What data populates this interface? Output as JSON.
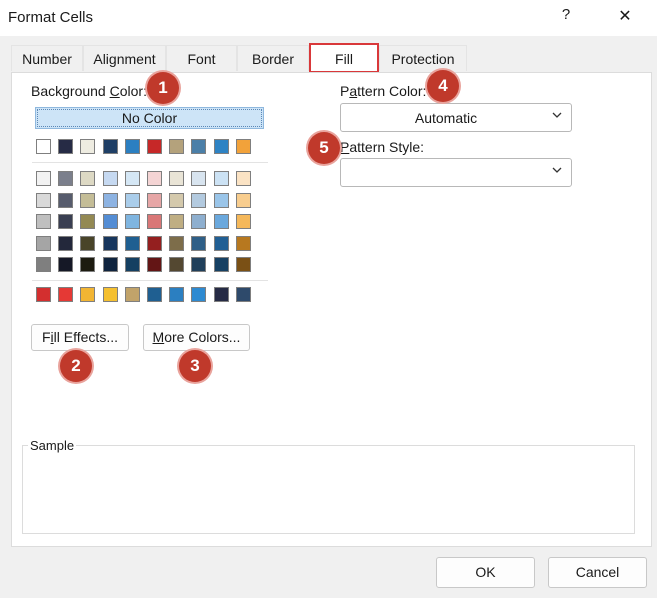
{
  "window": {
    "title": "Format Cells",
    "help": "?",
    "close": "✕"
  },
  "tabs": [
    {
      "label": "Number"
    },
    {
      "label": "Alignment"
    },
    {
      "label": "Font"
    },
    {
      "label": "Border"
    },
    {
      "label": "Fill"
    },
    {
      "label": "Protection"
    }
  ],
  "fill": {
    "background_label_pre": "Background ",
    "background_label_u": "C",
    "background_label_post": "olor:",
    "no_color": "No Color",
    "fill_effects_pre": "F",
    "fill_effects_u": "i",
    "fill_effects_post": "ll Effects...",
    "more_colors_pre": "",
    "more_colors_u": "M",
    "more_colors_post": "ore Colors...",
    "pattern_color_pre": "P",
    "pattern_color_u": "a",
    "pattern_color_post": "ttern Color:",
    "pattern_color_value": "Automatic",
    "pattern_style_pre": "",
    "pattern_style_u": "P",
    "pattern_style_post": "attern Style:",
    "pattern_style_value": "",
    "sample_label": "Sample"
  },
  "palette": {
    "theme_row": [
      "#ffffff",
      "#262b45",
      "#eeece1",
      "#1f3f66",
      "#2b7fc1",
      "#c62828",
      "#b4a27c",
      "#4b7fa8",
      "#2e83c4",
      "#f2a23a"
    ],
    "tint_rows": [
      [
        "#f2f2f2",
        "#7b7f8c",
        "#ddd9c4",
        "#c6d9f1",
        "#d5e7f5",
        "#f4d4d4",
        "#e9e4d6",
        "#d8e4ef",
        "#cce2f4",
        "#fbe3c4"
      ],
      [
        "#d9d9d9",
        "#575c6d",
        "#c4bd97",
        "#8db3e2",
        "#aacdea",
        "#e6a6a6",
        "#d4c9ac",
        "#b3cadf",
        "#9ac5e9",
        "#f8cd8e"
      ],
      [
        "#bfbfbf",
        "#3a3f52",
        "#938953",
        "#548dd4",
        "#7fb5e0",
        "#d97777",
        "#bfae83",
        "#8eafcf",
        "#6aa8dd",
        "#f5b85a"
      ],
      [
        "#a5a5a5",
        "#23283b",
        "#494429",
        "#17365d",
        "#1f5f91",
        "#941f1f",
        "#7d6d4a",
        "#2f5f87",
        "#215f94",
        "#b7781f"
      ],
      [
        "#7f7f7f",
        "#151826",
        "#1d1b10",
        "#0f243e",
        "#143f61",
        "#631515",
        "#544831",
        "#203f5a",
        "#164063",
        "#7a5015"
      ]
    ],
    "standard_row": [
      "#d32f2f",
      "#e53935",
      "#f2b533",
      "#f5c030",
      "#c1a36a",
      "#1f5f91",
      "#2b7fc1",
      "#2e8ad1",
      "#262b45",
      "#2e4a6b"
    ]
  },
  "badges": [
    "1",
    "2",
    "3",
    "4",
    "5"
  ],
  "footer": {
    "ok": "OK",
    "cancel": "Cancel"
  }
}
